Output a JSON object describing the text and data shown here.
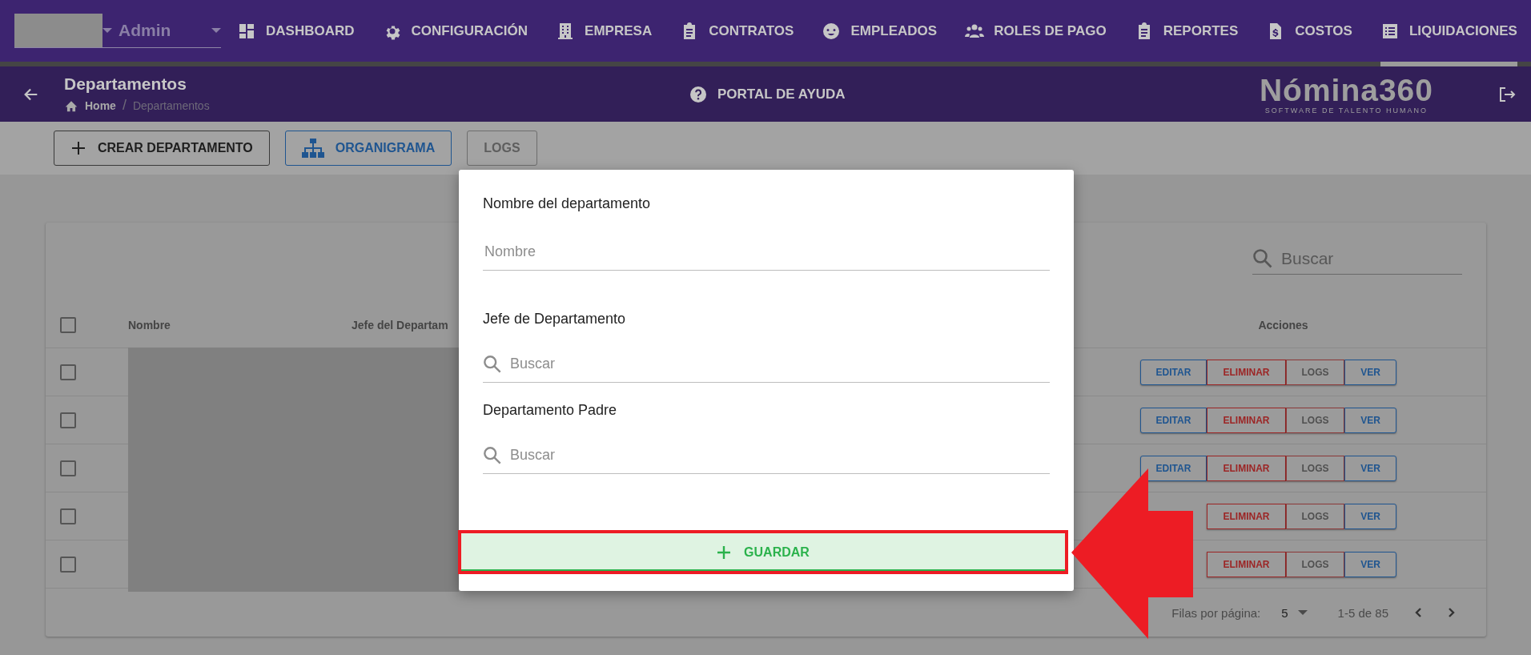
{
  "top_nav": {
    "user_role": "Admin",
    "items": [
      {
        "label": "DASHBOARD",
        "selected": false
      },
      {
        "label": "CONFIGURACIÓN",
        "selected": false
      },
      {
        "label": "EMPRESA",
        "selected": false
      },
      {
        "label": "CONTRATOS",
        "selected": false
      },
      {
        "label": "EMPLEADOS",
        "selected": false
      },
      {
        "label": "ROLES DE PAGO",
        "selected": false
      },
      {
        "label": "REPORTES",
        "selected": false
      },
      {
        "label": "COSTOS",
        "selected": false
      },
      {
        "label": "LIQUIDACIONES",
        "selected": true
      }
    ]
  },
  "header": {
    "title": "Departamentos",
    "breadcrumb": [
      "Home",
      "Departamentos"
    ],
    "breadcrumb_separator": "/",
    "help_link": "PORTAL DE AYUDA",
    "logo": {
      "name": "Nómina360",
      "tagline": "SOFTWARE DE TALENTO HUMANO"
    }
  },
  "toolbar": {
    "buttons": [
      {
        "label": "CREAR DEPARTAMENTO",
        "kind": "create"
      },
      {
        "label": "ORGANIGRAMA",
        "kind": "chart"
      },
      {
        "label": "LOGS",
        "kind": "plain"
      }
    ]
  },
  "table": {
    "search": {
      "placeholder": "Buscar"
    },
    "select_all_checked": false,
    "columns": [
      "Nombre",
      "Jefe del Departam",
      "Acciones"
    ],
    "rows": [
      {
        "checked": false,
        "actions": [
          {
            "label": "EDITAR",
            "kind": "edit"
          },
          {
            "label": "ELIMINAR",
            "kind": "delete"
          },
          {
            "label": "LOGS",
            "kind": "logs"
          },
          {
            "label": "VER",
            "kind": "view"
          }
        ]
      },
      {
        "checked": false,
        "actions": [
          {
            "label": "EDITAR",
            "kind": "edit"
          },
          {
            "label": "ELIMINAR",
            "kind": "delete"
          },
          {
            "label": "LOGS",
            "kind": "logs"
          },
          {
            "label": "VER",
            "kind": "view"
          }
        ]
      },
      {
        "checked": false,
        "actions": [
          {
            "label": "EDITAR",
            "kind": "edit"
          },
          {
            "label": "ELIMINAR",
            "kind": "delete"
          },
          {
            "label": "LOGS",
            "kind": "logs"
          },
          {
            "label": "VER",
            "kind": "view"
          }
        ]
      },
      {
        "checked": false,
        "actions": [
          {
            "label": "ELIMINAR",
            "kind": "delete"
          },
          {
            "label": "LOGS",
            "kind": "logs"
          },
          {
            "label": "VER",
            "kind": "view"
          }
        ]
      },
      {
        "checked": false,
        "actions": [
          {
            "label": "ELIMINAR",
            "kind": "delete"
          },
          {
            "label": "LOGS",
            "kind": "logs"
          },
          {
            "label": "VER",
            "kind": "view"
          }
        ]
      }
    ],
    "pagination": {
      "rows_per_page_label": "Filas por página:",
      "rows_per_page": "5",
      "range": "1-5 de 85"
    }
  },
  "dialog": {
    "fields": [
      {
        "label": "Nombre del departamento",
        "placeholder": "Nombre",
        "kind": "text"
      },
      {
        "label": "Jefe de Departamento",
        "placeholder": "Buscar",
        "kind": "search"
      },
      {
        "label": "Departamento Padre",
        "placeholder": "Buscar",
        "kind": "search"
      }
    ],
    "submit": "GUARDAR"
  }
}
